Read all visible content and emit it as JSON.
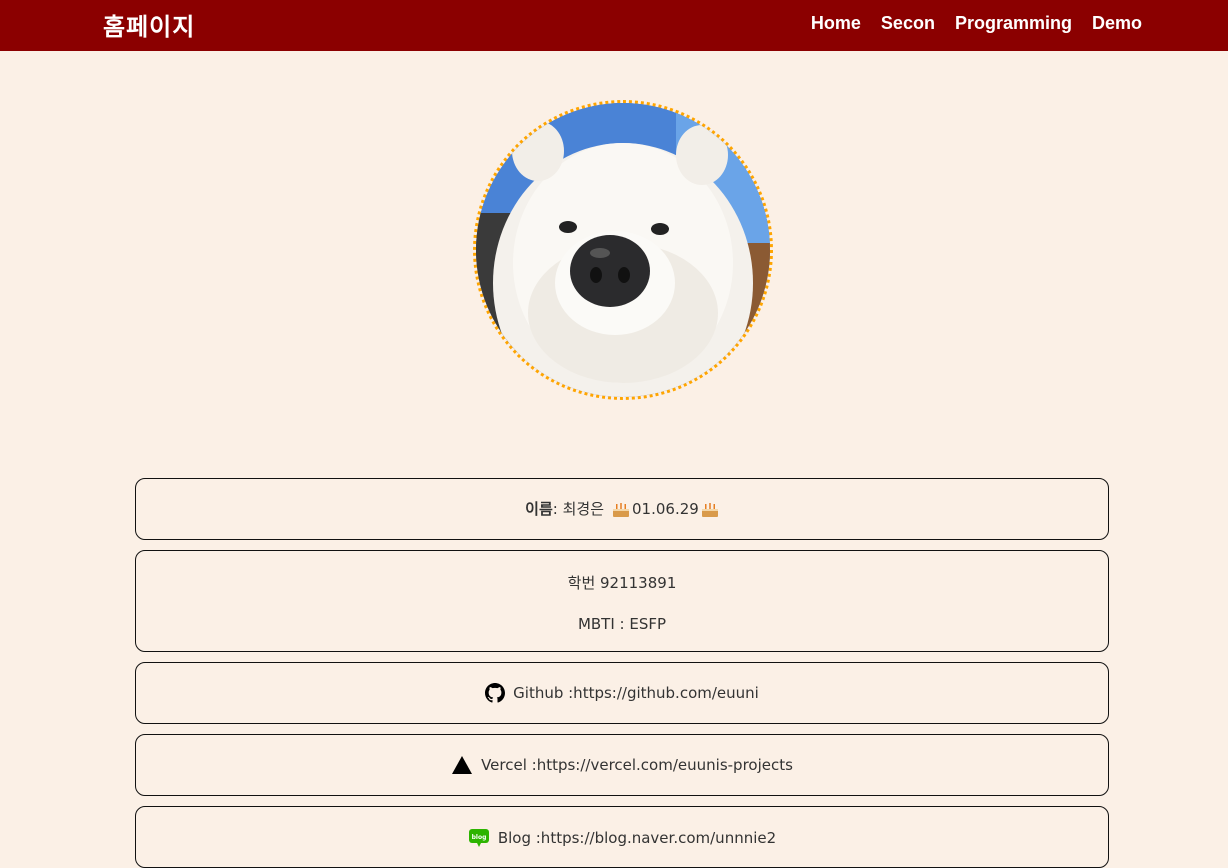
{
  "nav": {
    "brand": "홈페이지",
    "links": [
      "Home",
      "Secon",
      "Programming",
      "Demo"
    ]
  },
  "profile": {
    "name_label": "이름",
    "name_value": ": 최경은 ",
    "birthday": "01.06.29",
    "student_id": "학번 92113891",
    "mbti": "MBTI : ESFP",
    "github": "Github :https://github.com/euuni",
    "vercel": "Vercel :https://vercel.com/euunis-projects",
    "blog": "Blog :https://blog.naver.com/unnnie2",
    "icons": {
      "github": "github-icon",
      "vercel": "vercel-triangle-icon",
      "blog": "naver-blog-icon",
      "cake": "cake-icon"
    }
  },
  "colors": {
    "navbar": "#8B0000",
    "background": "#FBF0E6",
    "avatar_border": "#FFA500"
  }
}
